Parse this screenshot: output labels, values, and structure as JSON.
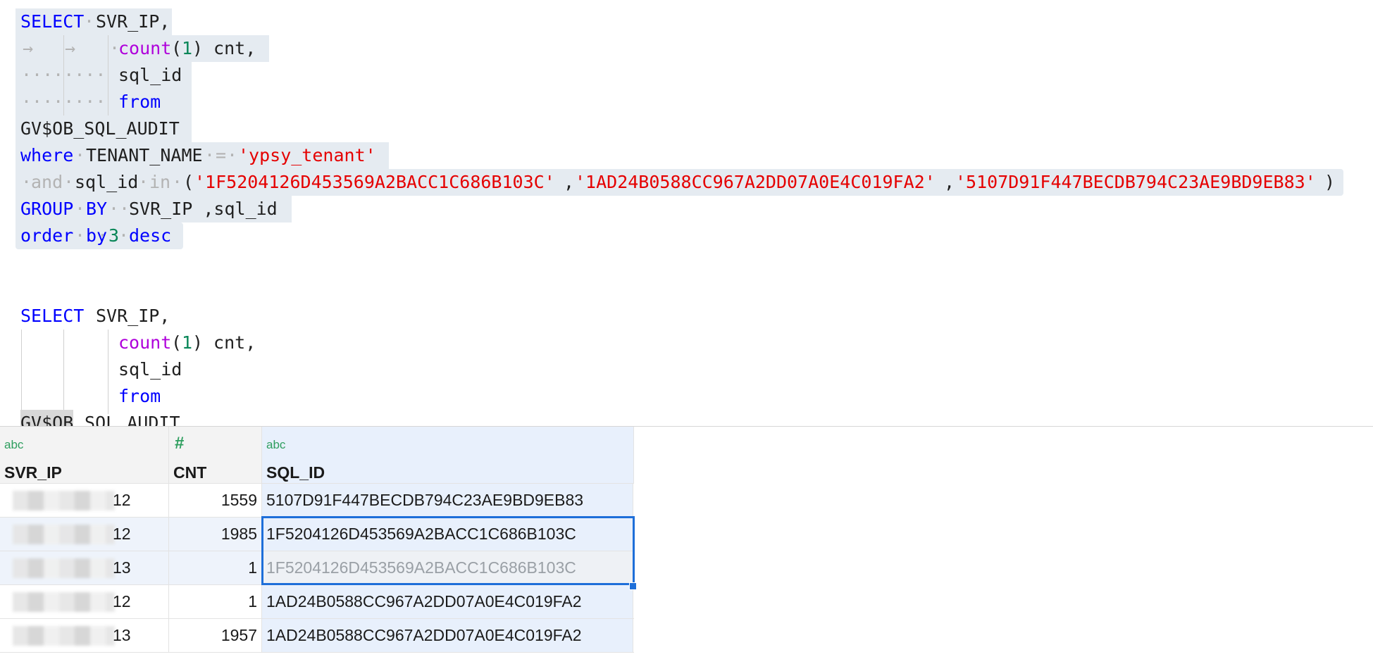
{
  "editor": {
    "query1": {
      "l1_kw": "SELECT",
      "l1_rest": "SVR_IP,",
      "l2_fn": "count",
      "l2_num": "1",
      "l2_rest": " cnt,",
      "l3": "sql_id",
      "l4_kw": "from",
      "l5": "GV$OB_SQL_AUDIT",
      "l6_kw": "where",
      "l6_id": "TENANT_NAME",
      "l6_op": "=",
      "l6_str": "'ypsy_tenant'",
      "l7_kw1": "and",
      "l7_id": "sql_id",
      "l7_kw2": "in",
      "l7_str1": "'1F5204126D453569A2BACC1C686B103C'",
      "l7_str2": "'1AD24B0588CC967A2DD07A0E4C019FA2'",
      "l7_str3": "'5107D91F447BECDB794C23AE9BD9EB83'",
      "l8_kw1": "GROUP",
      "l8_kw2": "BY",
      "l8_rest": "SVR_IP ,sql_id",
      "l9_kw1": "order",
      "l9_kw2": "by",
      "l9_num": "3",
      "l9_kw3": "desc"
    },
    "query2": {
      "l1_kw": "SELECT",
      "l1_rest": "SVR_IP,",
      "l2_fn": "count",
      "l2_num": "1",
      "l2_rest": " cnt,",
      "l3": "sql_id",
      "l4_kw": "from",
      "l5_hl": "GV$OB",
      "l5_rest": "_SQL_AUDIT"
    }
  },
  "grid": {
    "columns": [
      {
        "type": "abc",
        "name": "SVR_IP"
      },
      {
        "type": "#",
        "name": "CNT"
      },
      {
        "type": "abc",
        "name": "SQL_ID"
      }
    ],
    "rows": [
      {
        "ip_suffix": "12",
        "cnt": "1559",
        "sql_id": "5107D91F447BECDB794C23AE9BD9EB83"
      },
      {
        "ip_suffix": "12",
        "cnt": "1985",
        "sql_id": "1F5204126D453569A2BACC1C686B103C"
      },
      {
        "ip_suffix": "13",
        "cnt": "1",
        "sql_id": "1F5204126D453569A2BACC1C686B103C"
      },
      {
        "ip_suffix": "12",
        "cnt": "1",
        "sql_id": "1AD24B0588CC967A2DD07A0E4C019FA2"
      },
      {
        "ip_suffix": "13",
        "cnt": "1957",
        "sql_id": "1AD24B0588CC967A2DD07A0E4C019FA2"
      }
    ]
  },
  "colors": {
    "keyword": "#0000ff",
    "function": "#af00db",
    "number": "#098658",
    "string": "#e50000",
    "selection": "#e5ebf1",
    "cell_selection_border": "#1e6fd9",
    "type_icon": "#2e9e5e"
  }
}
